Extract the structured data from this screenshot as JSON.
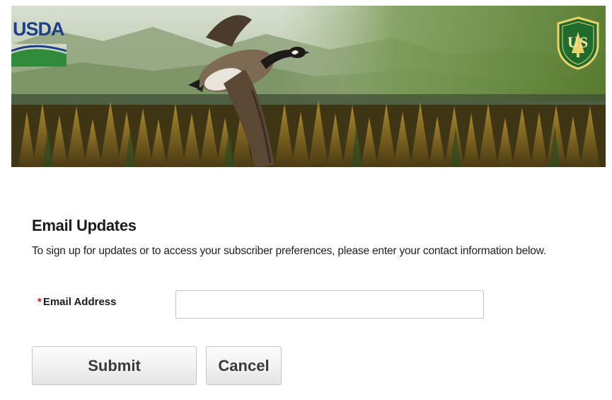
{
  "banner": {
    "agency_logo_text": "USDA",
    "forest_service_badge_text": "US",
    "colors": {
      "usda_blue": "#1e3f86",
      "usda_green": "#2f8a3a",
      "badge_green": "#1f6b2e",
      "badge_gold": "#e9d36a"
    },
    "icons": [
      "usda-logo",
      "forest-service-shield-icon",
      "goose-illustration",
      "forest-illustration"
    ]
  },
  "form": {
    "title": "Email Updates",
    "description": "To sign up for updates or to access your subscriber preferences, please enter your contact information below.",
    "email": {
      "required_marker": "*",
      "label": "Email Address",
      "value": "",
      "placeholder": ""
    },
    "submit_label": "Submit",
    "cancel_label": "Cancel"
  }
}
